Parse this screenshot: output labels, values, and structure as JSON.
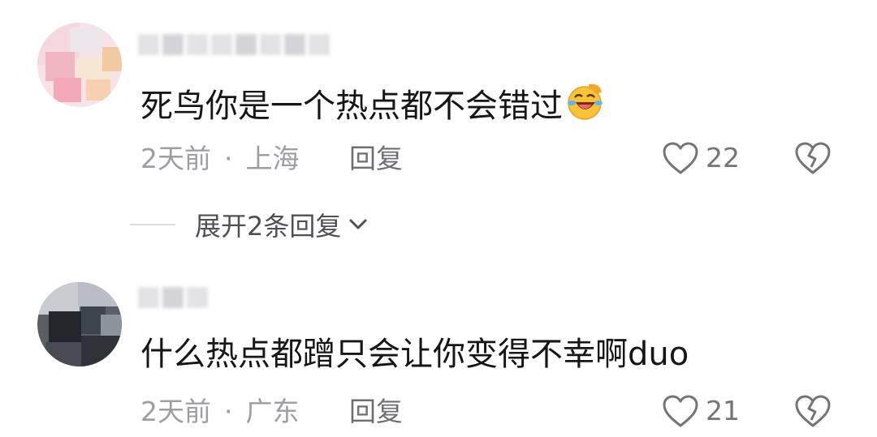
{
  "comments": [
    {
      "text": "死鸟你是一个热点都不会错过",
      "emoji": "rolling-laughing-face",
      "time": "2天前",
      "separator": "·",
      "location": "上海",
      "reply_label": "回复",
      "likes": "22"
    },
    {
      "text": "什么热点都蹭只会让你变得不幸啊duo",
      "time": "2天前",
      "separator": "·",
      "location": "广东",
      "reply_label": "回复",
      "likes": "21"
    }
  ],
  "expand_replies": {
    "label": "展开2条回复"
  },
  "colors": {
    "text": "#161616",
    "meta": "#9d9da3",
    "icon": "#757579"
  }
}
